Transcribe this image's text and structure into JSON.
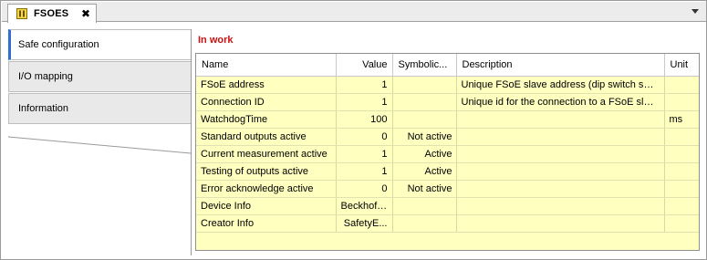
{
  "document_tab": {
    "title": "FSOES",
    "close_glyph": "✖",
    "icon": "module-icon",
    "overflow_icon": "chevron-down-icon"
  },
  "nav": {
    "items": [
      {
        "label": "Safe configuration",
        "active": true
      },
      {
        "label": "I/O mapping",
        "active": false
      },
      {
        "label": "Information",
        "active": false
      }
    ]
  },
  "status": {
    "text": "In work",
    "color": "#cc1010"
  },
  "table": {
    "columns": [
      "Name",
      "Value",
      "Symbolic...",
      "Description",
      "Unit"
    ],
    "rows": [
      {
        "name": "FSoE address",
        "value": "1",
        "symbolic": "",
        "description": "Unique FSoE slave address (dip switch sett...",
        "unit": ""
      },
      {
        "name": "Connection ID",
        "value": "1",
        "symbolic": "",
        "description": "Unique id for the connection to a FSoE slave",
        "unit": ""
      },
      {
        "name": "WatchdogTime",
        "value": "100",
        "symbolic": "",
        "description": "",
        "unit": "ms"
      },
      {
        "name": "Standard outputs active",
        "value": "0",
        "symbolic": "Not active",
        "description": "",
        "unit": ""
      },
      {
        "name": "Current measurement active",
        "value": "1",
        "symbolic": "Active",
        "description": "",
        "unit": ""
      },
      {
        "name": "Testing of outputs active",
        "value": "1",
        "symbolic": "Active",
        "description": "",
        "unit": ""
      },
      {
        "name": "Error acknowledge active",
        "value": "0",
        "symbolic": "Not active",
        "description": "",
        "unit": ""
      },
      {
        "name": "Device Info",
        "value": "Beckhoff...",
        "symbolic": "",
        "description": "",
        "unit": ""
      },
      {
        "name": "Creator Info",
        "value": "SafetyE...",
        "symbolic": "",
        "description": "",
        "unit": ""
      }
    ],
    "background_color": "#ffffc0"
  }
}
